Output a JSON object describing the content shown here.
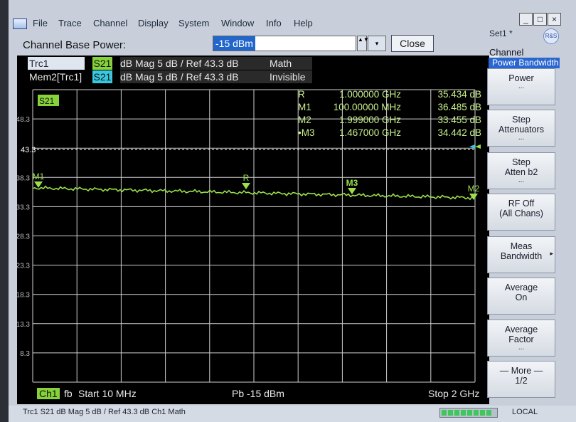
{
  "menu": [
    "File",
    "Trace",
    "Channel",
    "Display",
    "System",
    "Window",
    "Info",
    "Help"
  ],
  "window_controls": [
    "_",
    "□",
    "×"
  ],
  "set_name": "Set1 *",
  "logo_text": "R&S",
  "entry": {
    "label": "Channel Base Power:",
    "value": "-15 dBm",
    "close": "Close",
    "spin": "▲▼",
    "menu": "▾"
  },
  "traces": [
    {
      "name": "Trc1",
      "param": "S21",
      "info": "dB Mag  5 dB /  Ref 43.3 dB",
      "state": "Math"
    },
    {
      "name": "Mem2[Trc1]",
      "param": "S21",
      "info": "dB Mag  5 dB /  Ref 43.3 dB",
      "state": "Invisible"
    }
  ],
  "channel_tab": "1",
  "plot": {
    "label": "S21",
    "ref_value": "43.3",
    "y_ticks": [
      "48.3",
      "43.3",
      "38.3",
      "33.3",
      "28.3",
      "23.3",
      "18.3",
      "13.3",
      "8.3"
    ],
    "marker_labels": [
      "M1",
      "R",
      "M3",
      "M2"
    ]
  },
  "markers": [
    {
      "name": "R",
      "freq": "1.000000 GHz",
      "value": "35.434 dB"
    },
    {
      "name": "M1",
      "freq": "100.00000 MHz",
      "value": "36.485 dB"
    },
    {
      "name": "M2",
      "freq": "1.999000 GHz",
      "value": "33.455 dB"
    },
    {
      "name": "•M3",
      "freq": "1.467000 GHz",
      "value": "34.442 dB"
    }
  ],
  "bottom": {
    "ch": "Ch1",
    "fb": "fb",
    "start": "Start  10 MHz",
    "pb": "Pb  -15 dBm",
    "stop": "Stop  2 GHz"
  },
  "status": {
    "text": "Trc1   S21   dB Mag   5 dB / Ref 43.3 dB   Ch1   Math",
    "local": "LOCAL"
  },
  "softkeys": {
    "title": "Channel",
    "subtitle": "Power Bandwidth",
    "keys": [
      {
        "l1": "Power",
        "l2": "",
        "dots": "..."
      },
      {
        "l1": "Step",
        "l2": "Attenuators",
        "dots": "..."
      },
      {
        "l1": "Step",
        "l2": "Atten b2",
        "dots": "..."
      },
      {
        "l1": "RF Off",
        "l2": "(All Chans)",
        "dots": ""
      },
      {
        "l1": "Meas",
        "l2": "Bandwidth",
        "dots": "",
        "arrow": "▸"
      },
      {
        "l1": "Average",
        "l2": "On",
        "dots": ""
      },
      {
        "l1": "Average",
        "l2": "Factor",
        "dots": "..."
      },
      {
        "l1": "— More —",
        "l2": "1/2",
        "dots": ""
      }
    ]
  },
  "colors": {
    "trace": "#9be04a",
    "grid": "#cfcfcf",
    "marker_text": "#c8f08a",
    "accent": "#2a66d0"
  }
}
